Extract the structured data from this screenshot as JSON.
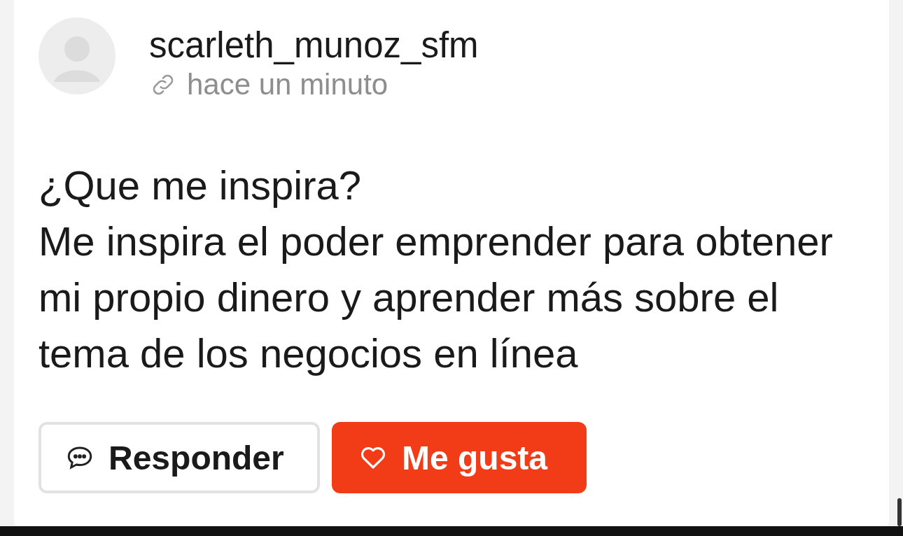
{
  "post": {
    "author": "scarleth_munoz_sfm",
    "time": "hace un minuto",
    "title": "¿Que me inspira?",
    "body": "Me inspira el poder emprender para obtener mi propio dinero y aprender más sobre el tema de los negocios en línea",
    "buttons": [
      {
        "kind": "reply",
        "label": "Responder"
      },
      {
        "kind": "like",
        "label": "Me gusta"
      }
    ]
  }
}
